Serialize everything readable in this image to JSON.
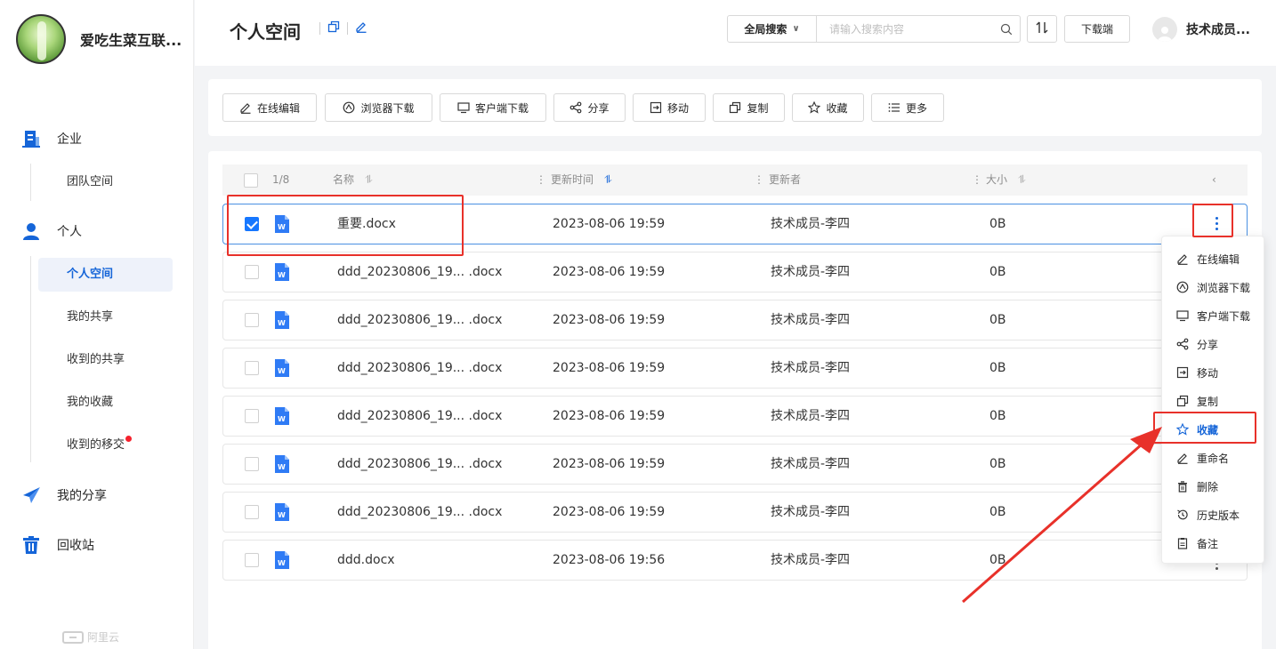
{
  "sidebar": {
    "org_name": "爱吃生菜互联...",
    "sections": [
      {
        "label": "企业",
        "icon": "enterprise-icon"
      },
      {
        "label": "个人",
        "icon": "person-icon"
      },
      {
        "label": "我的分享",
        "icon": "paper-plane-icon"
      },
      {
        "label": "回收站",
        "icon": "trash-icon"
      }
    ],
    "enterprise_items": [
      "团队空间"
    ],
    "personal_items": [
      "个人空间",
      "我的共享",
      "收到的共享",
      "我的收藏",
      "收到的移交"
    ],
    "footer_logo": "阿里云",
    "colors": {
      "active_bg": "#eef2fa",
      "accent": "#1565d8",
      "badge": "#f5222d"
    }
  },
  "header": {
    "title": "个人空间",
    "search_scope": "全局搜索",
    "search_placeholder": "请输入搜索内容",
    "download_client": "下载端",
    "user_name": "技术成员..."
  },
  "toolbar": {
    "buttons": [
      {
        "label": "在线编辑",
        "icon": "edit-icon"
      },
      {
        "label": "浏览器下载",
        "icon": "browser-download-icon"
      },
      {
        "label": "客户端下载",
        "icon": "monitor-icon"
      },
      {
        "label": "分享",
        "icon": "share-icon"
      },
      {
        "label": "移动",
        "icon": "move-icon"
      },
      {
        "label": "复制",
        "icon": "copy-icon"
      },
      {
        "label": "收藏",
        "icon": "star-icon"
      },
      {
        "label": "更多",
        "icon": "list-icon"
      }
    ]
  },
  "table": {
    "selection_count": "1/8",
    "columns": [
      "名称",
      "更新时间",
      "更新者",
      "大小"
    ],
    "rows": [
      {
        "name": "重要.docx",
        "time": "2023-08-06 19:59",
        "updater": "技术成员-李四",
        "size": "0B",
        "checked": true
      },
      {
        "name": "ddd_20230806_19... .docx",
        "time": "2023-08-06 19:59",
        "updater": "技术成员-李四",
        "size": "0B",
        "checked": false
      },
      {
        "name": "ddd_20230806_19... .docx",
        "time": "2023-08-06 19:59",
        "updater": "技术成员-李四",
        "size": "0B",
        "checked": false
      },
      {
        "name": "ddd_20230806_19... .docx",
        "time": "2023-08-06 19:59",
        "updater": "技术成员-李四",
        "size": "0B",
        "checked": false
      },
      {
        "name": "ddd_20230806_19... .docx",
        "time": "2023-08-06 19:59",
        "updater": "技术成员-李四",
        "size": "0B",
        "checked": false
      },
      {
        "name": "ddd_20230806_19... .docx",
        "time": "2023-08-06 19:59",
        "updater": "技术成员-李四",
        "size": "0B",
        "checked": false
      },
      {
        "name": "ddd_20230806_19... .docx",
        "time": "2023-08-06 19:59",
        "updater": "技术成员-李四",
        "size": "0B",
        "checked": false
      },
      {
        "name": "ddd.docx",
        "time": "2023-08-06 19:56",
        "updater": "技术成员-李四",
        "size": "0B",
        "checked": false
      }
    ]
  },
  "context_menu": {
    "items": [
      {
        "label": "在线编辑",
        "icon": "edit-icon"
      },
      {
        "label": "浏览器下载",
        "icon": "browser-download-icon"
      },
      {
        "label": "客户端下载",
        "icon": "monitor-icon"
      },
      {
        "label": "分享",
        "icon": "share-icon"
      },
      {
        "label": "移动",
        "icon": "move-icon"
      },
      {
        "label": "复制",
        "icon": "copy-icon"
      },
      {
        "label": "收藏",
        "icon": "star-icon",
        "highlighted": true
      },
      {
        "label": "重命名",
        "icon": "rename-icon"
      },
      {
        "label": "删除",
        "icon": "trash-icon"
      },
      {
        "label": "历史版本",
        "icon": "history-icon"
      },
      {
        "label": "备注",
        "icon": "note-icon"
      }
    ]
  },
  "annotation": {
    "color": "#e8312a"
  }
}
